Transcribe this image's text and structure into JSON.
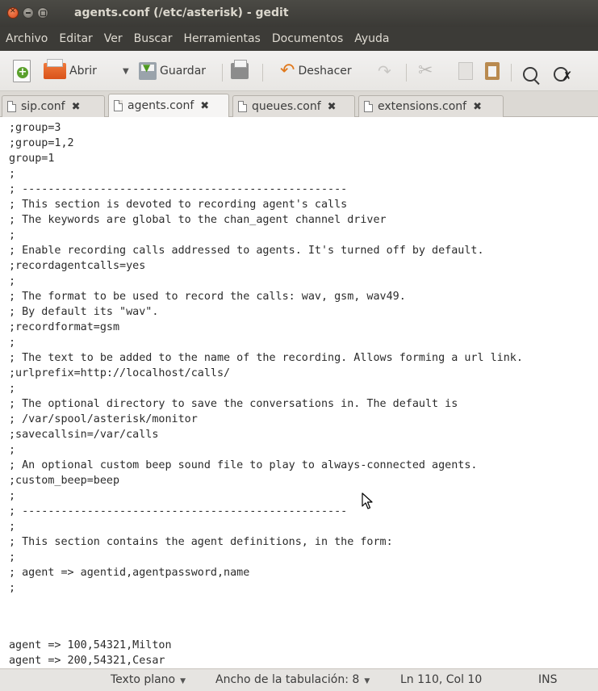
{
  "window": {
    "title": "agents.conf (/etc/asterisk) - gedit"
  },
  "menu": [
    "Archivo",
    "Editar",
    "Ver",
    "Buscar",
    "Herramientas",
    "Documentos",
    "Ayuda"
  ],
  "toolbar": {
    "open_label": "Abrir",
    "save_label": "Guardar",
    "undo_label": "Deshacer"
  },
  "tabs": [
    {
      "label": "sip.conf",
      "active": false
    },
    {
      "label": "agents.conf",
      "active": true
    },
    {
      "label": "queues.conf",
      "active": false
    },
    {
      "label": "extensions.conf",
      "active": false
    }
  ],
  "editor": {
    "lines": [
      ";group=3",
      ";group=1,2",
      "group=1",
      ";",
      "; --------------------------------------------------",
      "; This section is devoted to recording agent's calls",
      "; The keywords are global to the chan_agent channel driver",
      ";",
      "; Enable recording calls addressed to agents. It's turned off by default.",
      ";recordagentcalls=yes",
      ";",
      "; The format to be used to record the calls: wav, gsm, wav49.",
      "; By default its \"wav\".",
      ";recordformat=gsm",
      ";",
      "; The text to be added to the name of the recording. Allows forming a url link.",
      ";urlprefix=http://localhost/calls/",
      ";",
      "; The optional directory to save the conversations in. The default is",
      "; /var/spool/asterisk/monitor",
      ";savecallsin=/var/calls",
      ";",
      "; An optional custom beep sound file to play to always-connected agents.",
      ";custom_beep=beep",
      ";",
      "; --------------------------------------------------",
      ";",
      "; This section contains the agent definitions, in the form:",
      ";",
      "; agent => agentid,agentpassword,name",
      ";",
      "",
      "",
      "agent => 100,54321,Milton",
      "agent => 200,54321,Cesar"
    ]
  },
  "status": {
    "language": "Texto plano",
    "tab_width": "Ancho de la tabulación: 8",
    "position": "Ln 110, Col 10",
    "mode": "INS"
  }
}
